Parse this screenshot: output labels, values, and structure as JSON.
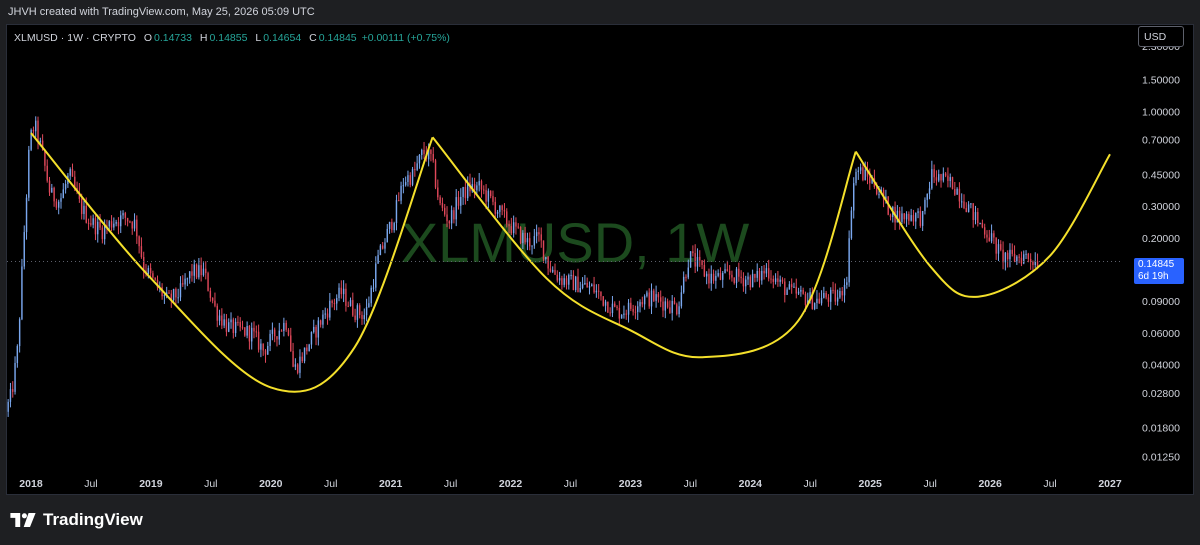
{
  "attribution": "JHVH created with TradingView.com, May 25, 2026 05:09 UTC",
  "legend": {
    "symbol": "XLMUSD",
    "interval": "1W",
    "exchange": "CRYPTO",
    "open_label": "O",
    "open": "0.14733",
    "high_label": "H",
    "high": "0.14855",
    "low_label": "L",
    "low": "0.14654",
    "close_label": "C",
    "close": "0.14845",
    "change": "+0.00111 (+0.75%)"
  },
  "currency_button": "USD",
  "watermark": "XLMUSD, 1W",
  "last_price": {
    "value": "0.14845",
    "countdown": "6d 19h"
  },
  "brand": "TradingView",
  "colors": {
    "background": "#000000",
    "frame": "#1e1f22",
    "up_candle": "#7aa7ee",
    "down_candle": "#e0485a",
    "curve": "#f4e02b",
    "watermark": "#1c4a1e",
    "label_bg": "#2962ff",
    "text": "#d1d4dc"
  },
  "chart_data": {
    "type": "candlestick",
    "scale": "log",
    "x_ticks": [
      "2018",
      "Jul",
      "2019",
      "Jul",
      "2020",
      "Jul",
      "2021",
      "Jul",
      "2022",
      "Jul",
      "2023",
      "Jul",
      "2024",
      "Jul",
      "2025",
      "Jul",
      "2026",
      "Jul",
      "2027"
    ],
    "x_tick_dates": [
      2018.0,
      2018.5,
      2019.0,
      2019.5,
      2020.0,
      2020.5,
      2021.0,
      2021.5,
      2022.0,
      2022.5,
      2023.0,
      2023.5,
      2024.0,
      2024.5,
      2025.0,
      2025.5,
      2026.0,
      2026.5,
      2027.0
    ],
    "y_ticks": [
      "2.30000",
      "1.50000",
      "1.00000",
      "0.70000",
      "0.45000",
      "0.30000",
      "0.20000",
      "0.14845",
      "0.09000",
      "0.06000",
      "0.04000",
      "0.02800",
      "0.01800",
      "0.01250"
    ],
    "y_tick_values": [
      2.3,
      1.5,
      1.0,
      0.7,
      0.45,
      0.3,
      0.2,
      0.09,
      0.06,
      0.04,
      0.028,
      0.018,
      0.0125
    ],
    "ylim": [
      0.0105,
      3.0
    ],
    "xlim": [
      2017.8,
      2027.1
    ],
    "last_price": 0.14845,
    "price_path": [
      [
        2017.8,
        0.022
      ],
      [
        2017.85,
        0.028
      ],
      [
        2017.9,
        0.05
      ],
      [
        2017.95,
        0.2
      ],
      [
        2018.0,
        0.7
      ],
      [
        2018.04,
        0.85
      ],
      [
        2018.1,
        0.6
      ],
      [
        2018.17,
        0.35
      ],
      [
        2018.25,
        0.32
      ],
      [
        2018.33,
        0.45
      ],
      [
        2018.42,
        0.3
      ],
      [
        2018.5,
        0.25
      ],
      [
        2018.6,
        0.22
      ],
      [
        2018.7,
        0.25
      ],
      [
        2018.8,
        0.26
      ],
      [
        2018.88,
        0.24
      ],
      [
        2018.95,
        0.14
      ],
      [
        2019.05,
        0.11
      ],
      [
        2019.15,
        0.09
      ],
      [
        2019.25,
        0.1
      ],
      [
        2019.35,
        0.13
      ],
      [
        2019.45,
        0.13
      ],
      [
        2019.55,
        0.08
      ],
      [
        2019.65,
        0.065
      ],
      [
        2019.75,
        0.062
      ],
      [
        2019.85,
        0.06
      ],
      [
        2019.95,
        0.048
      ],
      [
        2020.05,
        0.06
      ],
      [
        2020.15,
        0.07
      ],
      [
        2020.2,
        0.037
      ],
      [
        2020.3,
        0.048
      ],
      [
        2020.4,
        0.065
      ],
      [
        2020.5,
        0.085
      ],
      [
        2020.6,
        0.1
      ],
      [
        2020.7,
        0.08
      ],
      [
        2020.8,
        0.075
      ],
      [
        2020.9,
        0.15
      ],
      [
        2020.98,
        0.21
      ],
      [
        2021.05,
        0.28
      ],
      [
        2021.12,
        0.42
      ],
      [
        2021.2,
        0.45
      ],
      [
        2021.28,
        0.6
      ],
      [
        2021.35,
        0.55
      ],
      [
        2021.42,
        0.3
      ],
      [
        2021.5,
        0.25
      ],
      [
        2021.58,
        0.33
      ],
      [
        2021.66,
        0.38
      ],
      [
        2021.75,
        0.38
      ],
      [
        2021.85,
        0.32
      ],
      [
        2021.95,
        0.26
      ],
      [
        2022.05,
        0.22
      ],
      [
        2022.15,
        0.19
      ],
      [
        2022.25,
        0.2
      ],
      [
        2022.33,
        0.14
      ],
      [
        2022.42,
        0.12
      ],
      [
        2022.5,
        0.115
      ],
      [
        2022.6,
        0.11
      ],
      [
        2022.7,
        0.105
      ],
      [
        2022.8,
        0.09
      ],
      [
        2022.9,
        0.078
      ],
      [
        2023.0,
        0.082
      ],
      [
        2023.1,
        0.092
      ],
      [
        2023.2,
        0.094
      ],
      [
        2023.3,
        0.088
      ],
      [
        2023.4,
        0.083
      ],
      [
        2023.5,
        0.16
      ],
      [
        2023.58,
        0.14
      ],
      [
        2023.66,
        0.122
      ],
      [
        2023.75,
        0.12
      ],
      [
        2023.85,
        0.125
      ],
      [
        2023.95,
        0.12
      ],
      [
        2024.05,
        0.118
      ],
      [
        2024.15,
        0.135
      ],
      [
        2024.25,
        0.112
      ],
      [
        2024.35,
        0.1
      ],
      [
        2024.45,
        0.095
      ],
      [
        2024.55,
        0.09
      ],
      [
        2024.65,
        0.095
      ],
      [
        2024.75,
        0.093
      ],
      [
        2024.82,
        0.13
      ],
      [
        2024.86,
        0.38
      ],
      [
        2024.9,
        0.48
      ],
      [
        2024.95,
        0.45
      ],
      [
        2025.05,
        0.4
      ],
      [
        2025.15,
        0.3
      ],
      [
        2025.25,
        0.26
      ],
      [
        2025.35,
        0.27
      ],
      [
        2025.45,
        0.26
      ],
      [
        2025.52,
        0.45
      ],
      [
        2025.6,
        0.42
      ],
      [
        2025.7,
        0.4
      ],
      [
        2025.8,
        0.32
      ],
      [
        2025.9,
        0.25
      ],
      [
        2026.0,
        0.21
      ],
      [
        2026.1,
        0.16
      ],
      [
        2026.2,
        0.155
      ],
      [
        2026.3,
        0.16
      ],
      [
        2026.35,
        0.155
      ],
      [
        2026.4,
        0.148
      ]
    ],
    "curves": [
      [
        [
          2018.0,
          0.76
        ],
        [
          2019.0,
          0.12
        ],
        [
          2020.0,
          0.03
        ],
        [
          2020.7,
          0.05
        ],
        [
          2021.35,
          0.72
        ]
      ],
      [
        [
          2021.35,
          0.72
        ],
        [
          2022.3,
          0.12
        ],
        [
          2023.0,
          0.062
        ],
        [
          2023.6,
          0.044
        ],
        [
          2024.4,
          0.07
        ],
        [
          2024.88,
          0.6
        ]
      ],
      [
        [
          2024.88,
          0.6
        ],
        [
          2025.5,
          0.14
        ],
        [
          2025.9,
          0.095
        ],
        [
          2026.5,
          0.16
        ],
        [
          2027.0,
          0.58
        ]
      ]
    ]
  }
}
